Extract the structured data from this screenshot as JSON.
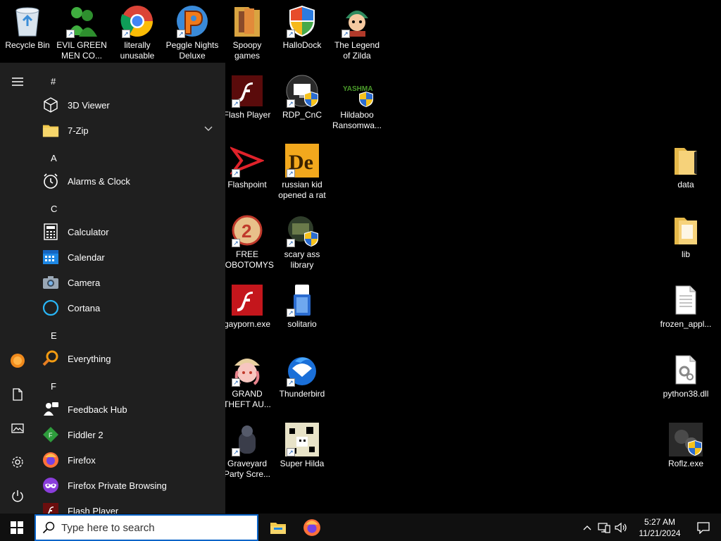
{
  "desktop": {
    "icons": [
      {
        "label": "Recycle Bin"
      },
      {
        "label": "EVIL GREEN MEN CO..."
      },
      {
        "label": "literally unusable"
      },
      {
        "label": "Peggle Nights Deluxe"
      },
      {
        "label": "Spoopy games"
      },
      {
        "label": "HalloDock"
      },
      {
        "label": "The Legend of Zilda"
      },
      {
        "label": "Flash Player"
      },
      {
        "label": "RDP_CnC"
      },
      {
        "label": "Hildaboo Ransomwa..."
      },
      {
        "label": "Flashpoint"
      },
      {
        "label": "russian kid opened a rat"
      },
      {
        "label": "FREE LOBOTOMYS"
      },
      {
        "label": "scary ass library"
      },
      {
        "label": "gayporn.exe"
      },
      {
        "label": "solitario"
      },
      {
        "label": "GRAND THEFT AU..."
      },
      {
        "label": "Thunderbird"
      },
      {
        "label": "Graveyard Party Scre..."
      },
      {
        "label": "Super Hilda"
      },
      {
        "label": "data"
      },
      {
        "label": "lib"
      },
      {
        "label": "frozen_appl..."
      },
      {
        "label": "python38.dll"
      },
      {
        "label": "Roflz.exe"
      }
    ]
  },
  "start_menu": {
    "sections": {
      "hash": "#",
      "a": "A",
      "c": "C",
      "e": "E",
      "f": "F"
    },
    "apps": [
      {
        "label": "3D Viewer",
        "icon": "cube-icon"
      },
      {
        "label": "7-Zip",
        "icon": "folder-icon"
      },
      {
        "label": "Alarms & Clock",
        "icon": "alarm-clock-icon"
      },
      {
        "label": "Calculator",
        "icon": "calculator-icon"
      },
      {
        "label": "Calendar",
        "icon": "calendar-icon"
      },
      {
        "label": "Camera",
        "icon": "camera-icon"
      },
      {
        "label": "Cortana",
        "icon": "cortana-icon"
      },
      {
        "label": "Everything",
        "icon": "magnifier-icon"
      },
      {
        "label": "Feedback Hub",
        "icon": "feedback-icon"
      },
      {
        "label": "Fiddler 2",
        "icon": "fiddler-icon"
      },
      {
        "label": "Firefox",
        "icon": "firefox-icon"
      },
      {
        "label": "Firefox Private Browsing",
        "icon": "private-browsing-icon"
      },
      {
        "label": "Flash Player",
        "icon": "flash-icon"
      }
    ]
  },
  "taskbar": {
    "search_placeholder": "Type here to search",
    "time": "5:27 AM",
    "date": "11/21/2024"
  },
  "colors": {
    "accent": "#0a64c8",
    "start_bg": "#1f1f1f",
    "taskbar_bg": "#101010",
    "flash_red": "#c4161c"
  }
}
